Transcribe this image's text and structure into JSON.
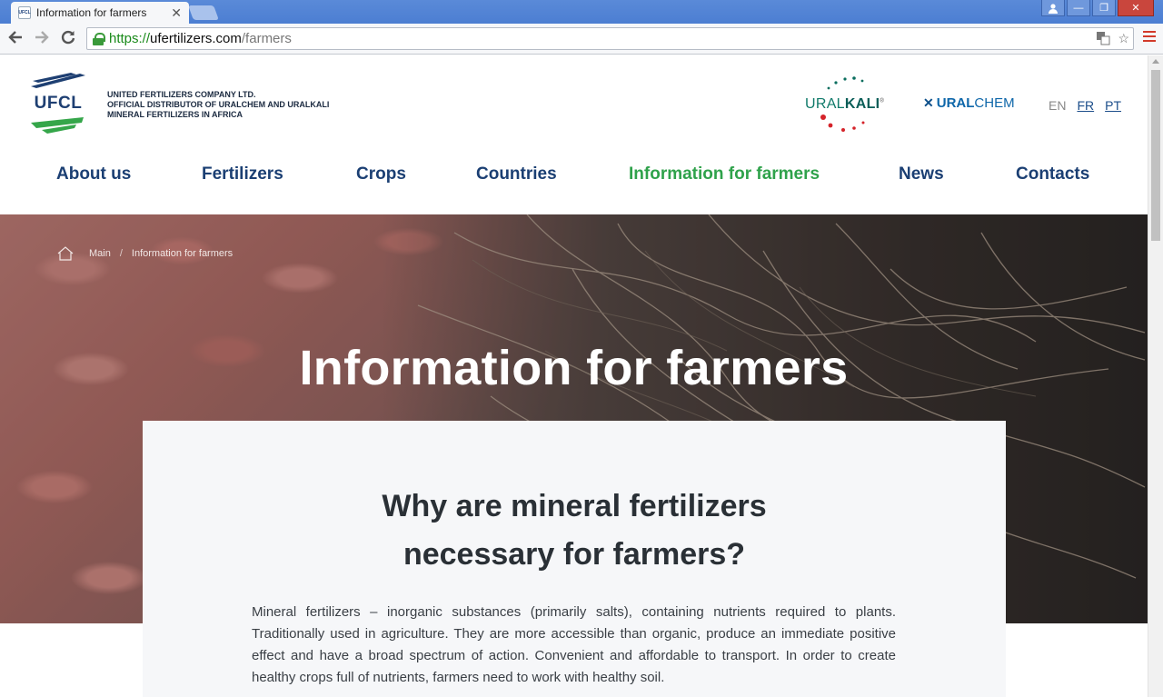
{
  "browser": {
    "tab_title": "Information for farmers",
    "favicon_text": "UFCL",
    "url_scheme": "https://",
    "url_host": "ufertilizers.com",
    "url_path": "/farmers"
  },
  "header": {
    "logo_text": "UFCL",
    "company_line1": "UNITED FERTILIZERS COMPANY LTD.",
    "company_line2": "OFFICIAL DISTRIBUTOR OF URALCHEM AND URALKALI",
    "company_line3": "MINERAL FERTILIZERS IN AFRICA",
    "uralkali_light": "URAL",
    "uralkali_bold": "KALI",
    "uralkali_reg": "®",
    "uralchem_mark": "✕",
    "uralchem_light": "URAL",
    "uralchem_bold": "CHEM"
  },
  "languages": {
    "current": "EN",
    "links": [
      "FR",
      "PT"
    ]
  },
  "nav": {
    "items": [
      "About us",
      "Fertilizers",
      "Crops",
      "Countries",
      "Information for farmers",
      "News",
      "Contacts"
    ],
    "active": "Information for farmers"
  },
  "breadcrumb": {
    "items": [
      "Main",
      "Information for farmers"
    ],
    "separator": "/"
  },
  "hero": {
    "title": "Information for farmers"
  },
  "article": {
    "title_line1": "Why are mineral fertilizers",
    "title_line2": "necessary for farmers?",
    "body": "Mineral fertilizers – inorganic substances (primarily salts), containing nutrients required to plants. Traditionally used in agriculture. They are more accessible than organic, produce an immediate positive effect and have a broad spectrum of action. Convenient and affordable to transport. In order to create healthy crops full of nutrients, farmers need to work with healthy soil."
  },
  "colors": {
    "nav_default": "#1b3f73",
    "nav_active": "#2fa24b",
    "chrome_blue": "#4c7ed2"
  }
}
